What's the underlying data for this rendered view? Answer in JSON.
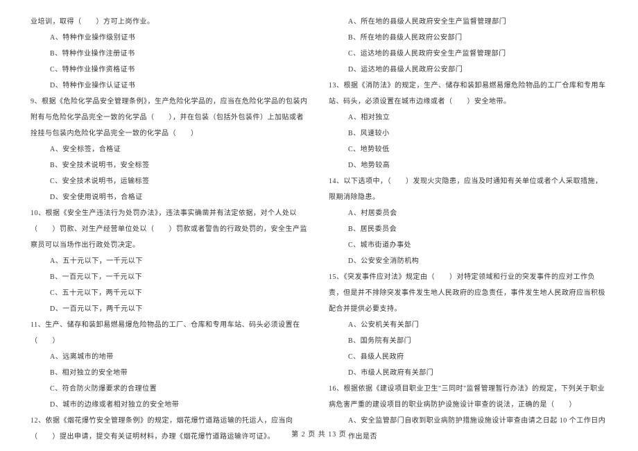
{
  "left": {
    "intro": "业培训，取得（　　）方可上岗作业。",
    "q8_options": [
      "A、特种作业操作级别证书",
      "B、特种作业操作注册证书",
      "C、特种作业操作资格证书",
      "D、特种作业操作认证证书"
    ],
    "q9_text": "9、根据《危险化学品安全管理条例》，生产危险化学品的，应当在危险化学品的包装内附有与危险化学品完全一致的化学品（　　），并在包装（包括外包装件）上加贴或者拴挂与包装内危险化学品完全一致的化学品（　　）",
    "q9_options": [
      "A、安全标签，合格证",
      "B、安全技术说明书，安全标签",
      "C、安全技术说明书，运输标签",
      "D、安全使用说明书，合格证"
    ],
    "q10_text": "10、根据《安全生产违法行为处罚办法》，违法事实确凿并有法定依据，对个人处以（　　）罚款、对生产经营单位处以（　　）罚款或者警告的行政处罚的，安全生产监察员可以当场作出行政处罚决定。",
    "q10_options": [
      "A、五十元以下，一千元以下",
      "B、一百元以下，一千元以下",
      "C、五十元以下，两千元以下",
      "D、一百元以下，两千元以下"
    ],
    "q11_text": "11、生产、储存和装卸易燃易爆危险物品的工厂、仓库和专用车站、码头必须设置在（　　）",
    "q11_options": [
      "A、远离城市的地带",
      "B、相对独立的安全地带",
      "C、符合防火防爆要求的合理位置",
      "D、城市的边缘或者相对独立的安全地带"
    ],
    "q12_text": "12、依据《烟花爆竹安全管理条例》的规定，烟花爆竹道路运输的托运人，应当向（　　）提出申请，提交有关证明材料，办理《烟花爆竹道路运输许可证》。"
  },
  "right": {
    "q12_options": [
      "A、所在地的县级人民政府安全生产监督管理部门",
      "B、所在地的县级人民政府公安部门",
      "C、运达地的县级人民政府安全生产监督管理部门",
      "D、运达地的县级人民政府公安部门"
    ],
    "q13_text": "13、根据《消防法》的规定，生产、储存和装卸易燃易爆危险物品的工厂仓库和专用车站、码头，必须设置在城市边缘或者（　　）安全地带。",
    "q13_options": [
      "A、相对独立",
      "B、风速较小",
      "C、地势较低",
      "D、地势较高"
    ],
    "q14_text": "14、以下选项中，（　　）发现火灾隐患，应当及时通知有关单位或者个人采取措施，限期消除隐患。",
    "q14_options": [
      "A、村居委员会",
      "B、居民委员会",
      "C、城市街道办事处",
      "D、公安安全消防机构"
    ],
    "q15_text": "15、《突发事件应对法》规定由（　　）对特定领域和行业的突发事件的应对工作负责，但是并不排除突发事件发生地人民政府的应急责任，事件发生地人民政府应当积极配合并提供必要支持。",
    "q15_options": [
      "A、公安机关有关部门",
      "B、国务院有关部门",
      "C、县级人民政府",
      "D、市级人民政府有关部门"
    ],
    "q16_text": "16、根据依据《建设项目职业卫生\"三同时\"监督管理暂行办法》的规定，下列关于职业病危害严重的建设项目的职业病防护设施设计审查的说法，正确的是（　　）",
    "q16_optA": "A、安全监管部门自收到职业病防护措施设施设计审查由请之日起 10 个工作日内作出是否"
  },
  "footer": "第 2 页 共 13 页"
}
